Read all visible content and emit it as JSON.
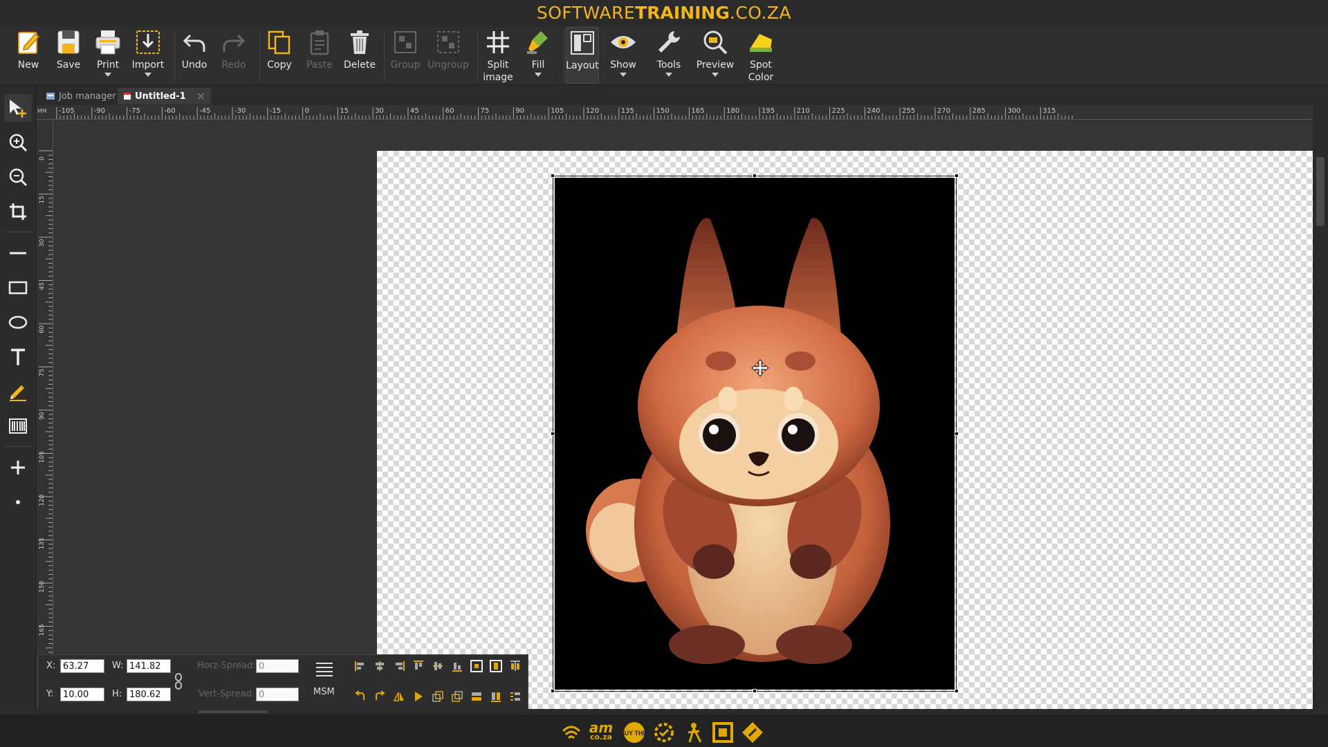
{
  "titlebar": {
    "brand_light": "SOFTWARE",
    "brand_bold": "TRAINING",
    "brand_suffix": ".CO.ZA"
  },
  "toolbar": {
    "new": "New",
    "save": "Save",
    "print": "Print",
    "import": "Import",
    "undo": "Undo",
    "redo": "Redo",
    "copy": "Copy",
    "paste": "Paste",
    "delete": "Delete",
    "group": "Group",
    "ungroup": "Ungroup",
    "split_image_1": "Split",
    "split_image_2": "image",
    "fill": "Fill",
    "layout": "Layout",
    "show": "Show",
    "tools": "Tools",
    "preview": "Preview",
    "spot_color_1": "Spot",
    "spot_color_2": "Color"
  },
  "tabs": [
    {
      "label": "Job manager"
    },
    {
      "label": "Untitled-1"
    }
  ],
  "ruler": {
    "unit": "MM",
    "h_ticks": [
      "-105",
      "-90",
      "-75",
      "-60",
      "-45",
      "-30",
      "-15",
      "0",
      "15",
      "30",
      "45",
      "60",
      "75",
      "90",
      "105",
      "120",
      "135",
      "150",
      "165",
      "180",
      "195",
      "210",
      "225",
      "240",
      "255",
      "270",
      "285",
      "300",
      "315"
    ],
    "v_ticks": [
      "0",
      "15",
      "30",
      "45",
      "60",
      "75",
      "90",
      "105",
      "120",
      "135",
      "150",
      "165"
    ]
  },
  "props": {
    "x_label": "X:",
    "x_value": "63.27",
    "y_label": "Y:",
    "y_value": "10.00",
    "w_label": "W:",
    "w_value": "141.82",
    "h_label": "H:",
    "h_value": "180.62",
    "horz_spread_label": "Horz-Spread:",
    "horz_spread_value": "0",
    "vert_spread_label": "Vert-Spread:",
    "vert_spread_value": "0",
    "msm_label": "MSM"
  },
  "footer": {
    "logo_am": "am",
    "logo_coza": "co.za",
    "logo_buy": "BUY THIS"
  },
  "colors": {
    "accent": "#f2b51c",
    "background": "#2d2d2d",
    "canvas": "#353535",
    "selection": "#111111"
  }
}
